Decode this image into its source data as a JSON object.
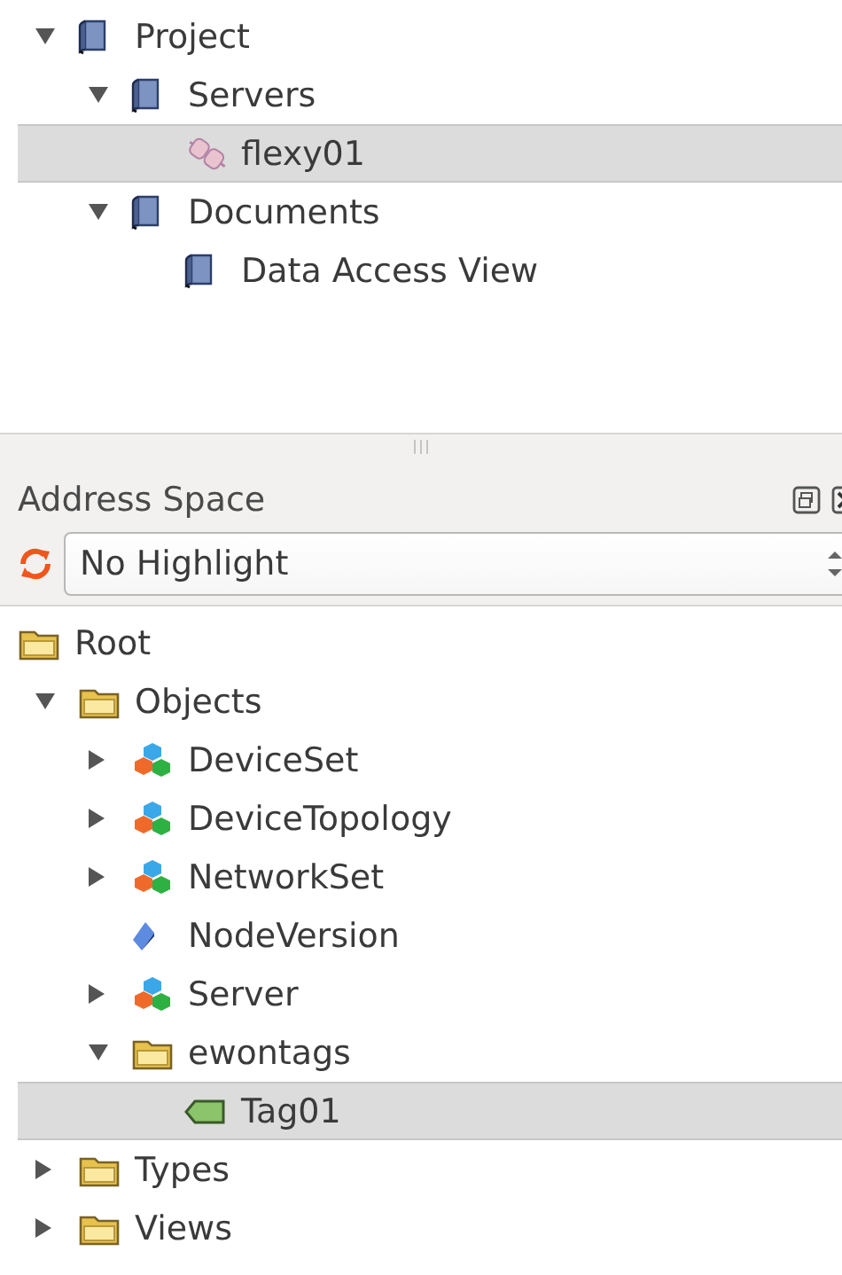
{
  "project_tree": {
    "items": [
      {
        "label": "Project",
        "kind": "book",
        "expanded": true,
        "selected": false,
        "children": [
          {
            "label": "Servers",
            "kind": "book",
            "expanded": true,
            "selected": false,
            "children": [
              {
                "label": "flexy01",
                "kind": "server",
                "selected": true
              }
            ]
          },
          {
            "label": "Documents",
            "kind": "book",
            "expanded": true,
            "selected": false,
            "children": [
              {
                "label": "Data Access View",
                "kind": "book",
                "selected": false
              }
            ]
          }
        ]
      }
    ]
  },
  "address_space": {
    "title": "Address Space",
    "highlight": {
      "value": "No Highlight"
    },
    "items": [
      {
        "label": "Root",
        "kind": "folder",
        "selected": false,
        "children": [
          {
            "label": "Objects",
            "kind": "folder",
            "expanded": true,
            "selected": false,
            "children": [
              {
                "label": "DeviceSet",
                "kind": "objects",
                "expanded": false,
                "selected": false
              },
              {
                "label": "DeviceTopology",
                "kind": "objects",
                "expanded": false,
                "selected": false
              },
              {
                "label": "NetworkSet",
                "kind": "objects",
                "expanded": false,
                "selected": false
              },
              {
                "label": "NodeVersion",
                "kind": "variable",
                "selected": false
              },
              {
                "label": "Server",
                "kind": "objects",
                "expanded": false,
                "selected": false
              },
              {
                "label": "ewontags",
                "kind": "folder",
                "expanded": true,
                "selected": false,
                "children": [
                  {
                    "label": "Tag01",
                    "kind": "tag",
                    "selected": true
                  }
                ]
              }
            ]
          },
          {
            "label": "Types",
            "kind": "folder",
            "expanded": false,
            "selected": false
          },
          {
            "label": "Views",
            "kind": "folder",
            "expanded": false,
            "selected": false
          }
        ]
      }
    ]
  }
}
